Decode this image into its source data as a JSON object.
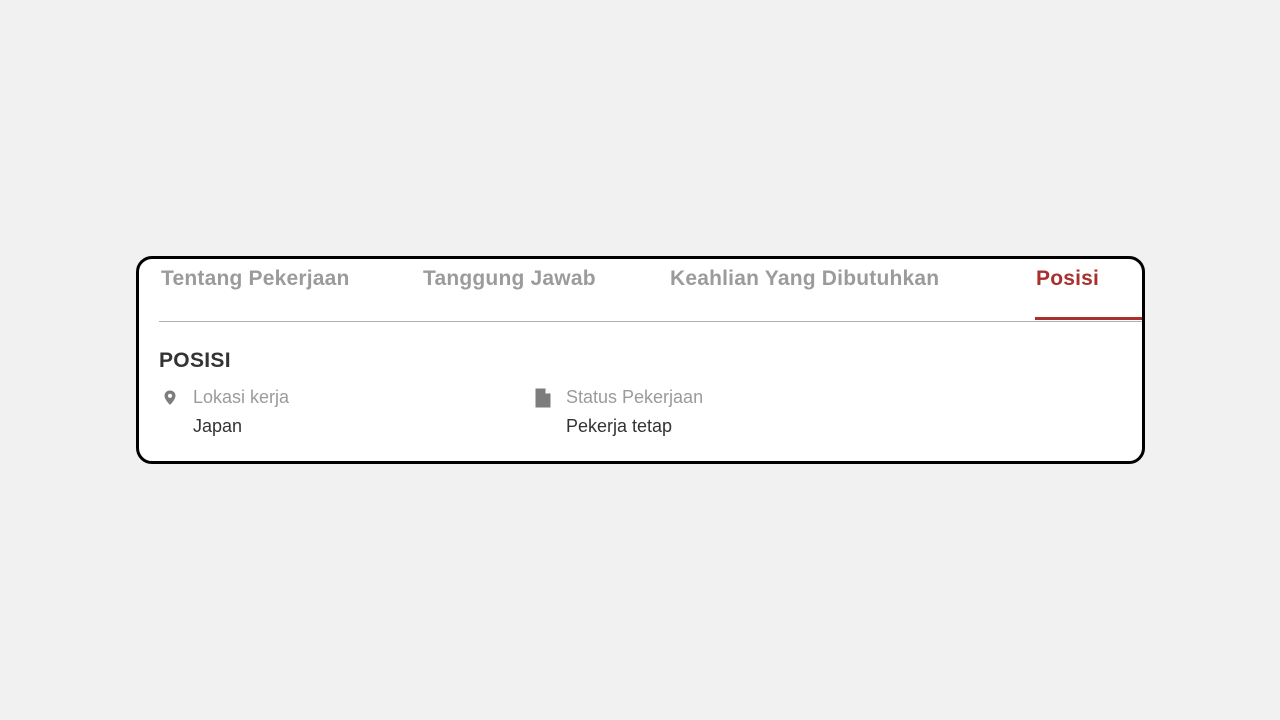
{
  "tabs": [
    {
      "label": "Tentang Pekerjaan",
      "active": false
    },
    {
      "label": "Tanggung Jawab",
      "active": false
    },
    {
      "label": "Keahlian Yang Dibutuhkan",
      "active": false
    },
    {
      "label": "Posisi",
      "active": true
    }
  ],
  "section": {
    "title": "POSISI",
    "location": {
      "icon": "location-pin-icon",
      "label": "Lokasi kerja",
      "value": "Japan"
    },
    "status": {
      "icon": "document-icon",
      "label": "Status Pekerjaan",
      "value": "Pekerja tetap"
    }
  },
  "colors": {
    "accent": "#a8302e",
    "muted": "#9b9b9b",
    "text": "#333333",
    "background": "#f1f1f1"
  }
}
